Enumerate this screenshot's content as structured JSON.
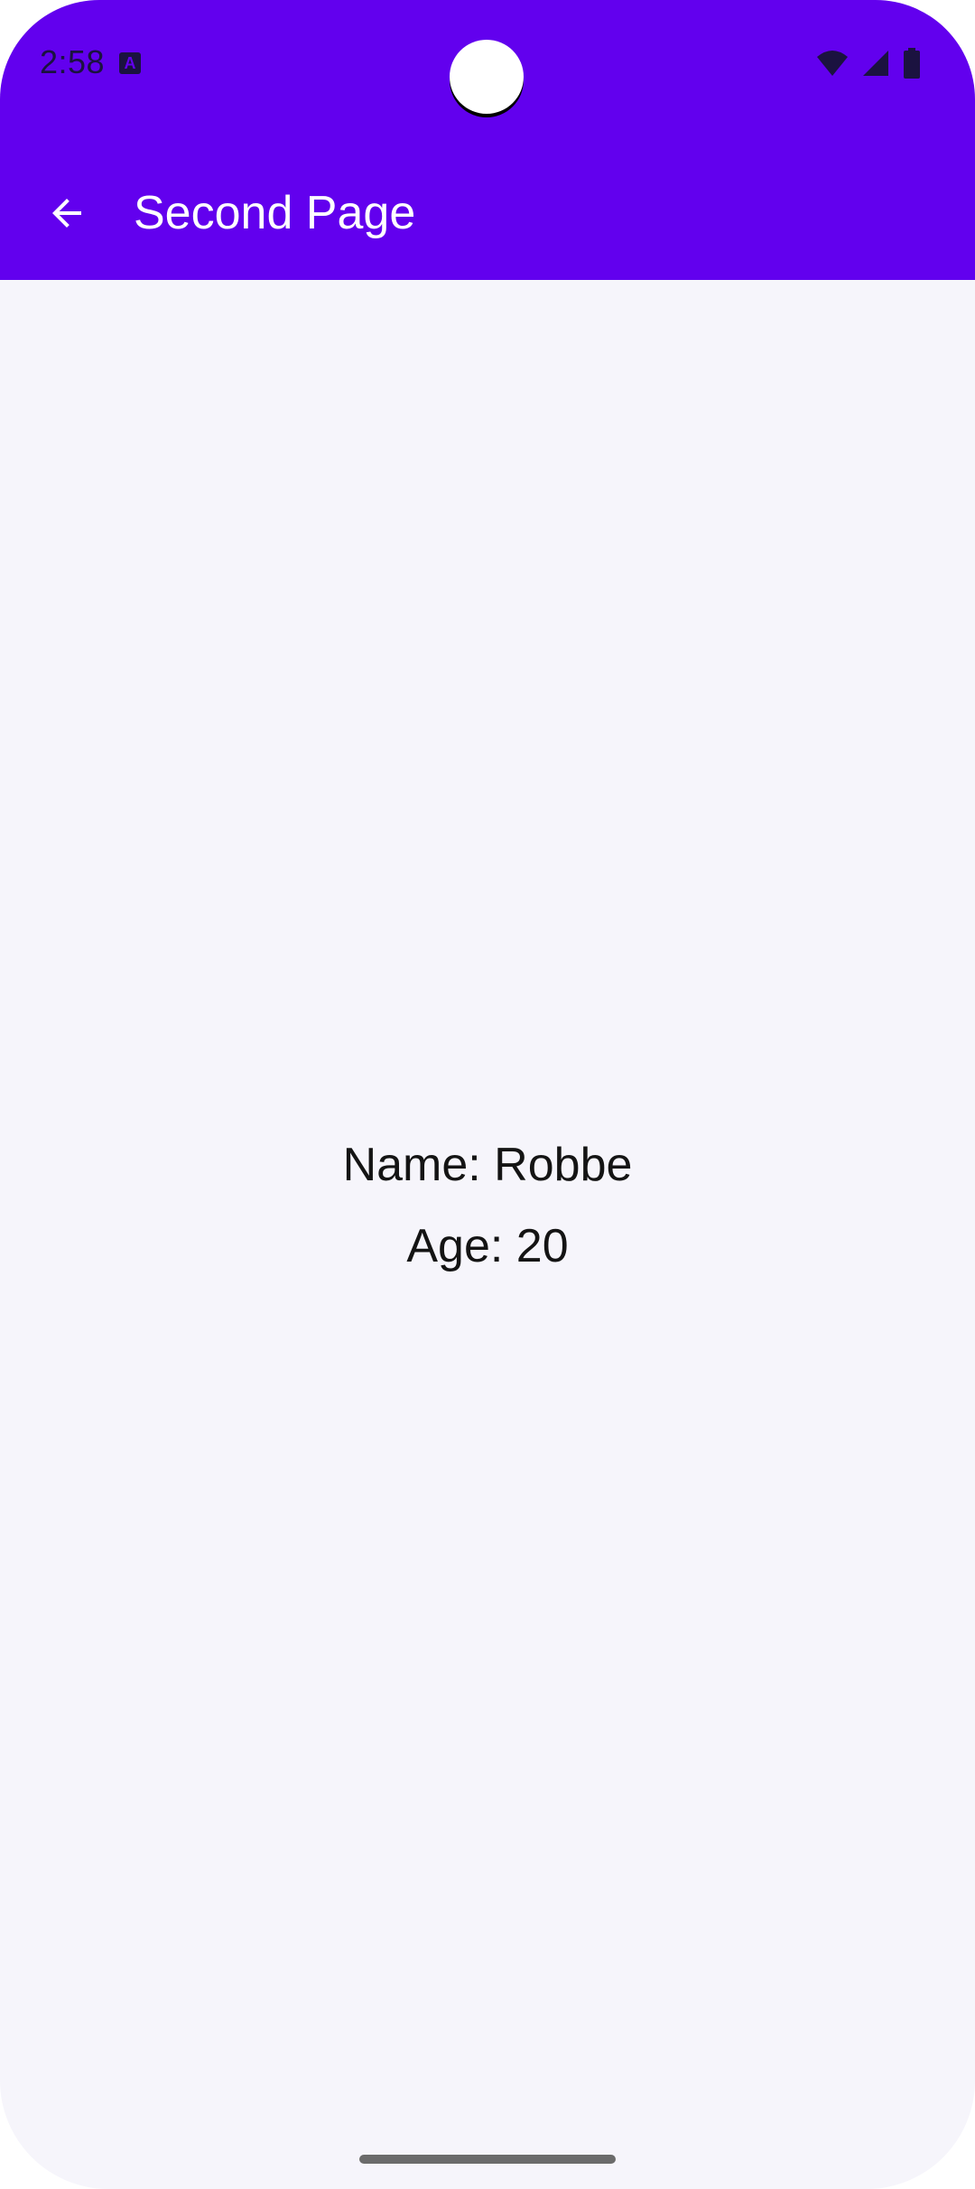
{
  "status_bar": {
    "time": "2:58",
    "notification_icon": "a-badge-icon",
    "wifi_icon": "wifi-icon",
    "signal_icon": "signal-icon",
    "battery_icon": "battery-icon"
  },
  "app_bar": {
    "back_icon": "arrow-left-icon",
    "title": "Second Page",
    "color": "#6200ee"
  },
  "content": {
    "name_text": "Name: Robbe",
    "age_text": "Age: 20"
  },
  "colors": {
    "primary": "#6200ee",
    "background": "#f6f5fb",
    "text": "#141414"
  }
}
